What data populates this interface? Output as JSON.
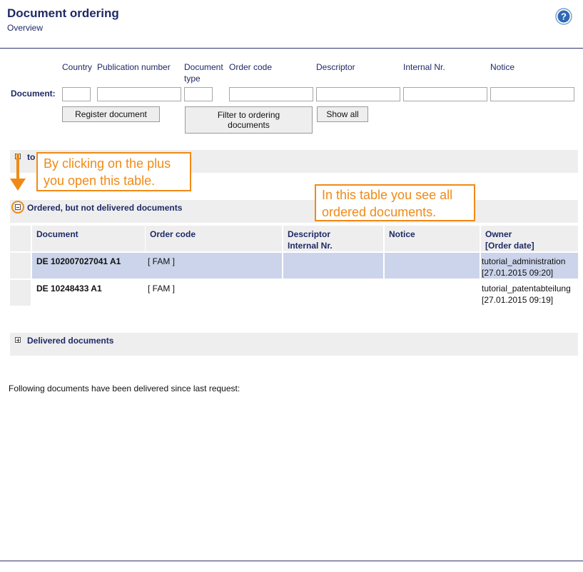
{
  "header": {
    "title": "Document ordering",
    "subtitle": "Overview",
    "help_icon": "?"
  },
  "form": {
    "columns": {
      "country": "Country",
      "publication_number": "Publication number",
      "document_type": "Document type",
      "order_code": "Order code",
      "descriptor": "Descriptor",
      "internal_nr": "Internal Nr.",
      "notice": "Notice"
    },
    "row_label": "Document:",
    "values": {
      "country": "",
      "publication_number": "",
      "document_type": "",
      "order_code": "",
      "descriptor": "",
      "internal_nr": "",
      "notice": ""
    },
    "buttons": {
      "register": "Register document",
      "filter": "Filter to ordering documents",
      "show_all": "Show all"
    }
  },
  "sections": {
    "first_partial": "to",
    "ordered_not_delivered": "Ordered, but not delivered documents",
    "delivered": "Delivered documents"
  },
  "table": {
    "headers": [
      "Document",
      "Order code",
      "Descriptor\nInternal Nr.",
      "Notice",
      "Owner\n[Order date]"
    ],
    "rows": [
      {
        "document": "DE 102007027041 A1",
        "order_code": "[ FAM ]",
        "descriptor": "",
        "notice": "",
        "owner": "tutorial_administration",
        "order_date": "[27.01.2015 09:20]"
      },
      {
        "document": "DE 10248433 A1",
        "order_code": "[ FAM ]",
        "descriptor": "",
        "notice": "",
        "owner": "tutorial_patentabteilung",
        "order_date": "[27.01.2015 09:19]"
      }
    ]
  },
  "callouts": {
    "plus_hint": "By clicking on the plus you open this table.",
    "table_hint": "In this table you see all ordered documents."
  },
  "footer_note": "Following documents have been delivered since last request:",
  "colors": {
    "accent": "#1f2a66",
    "callout": "#f08a16",
    "selected_row": "#cbd4ea",
    "section_bg": "#eeeeee"
  }
}
